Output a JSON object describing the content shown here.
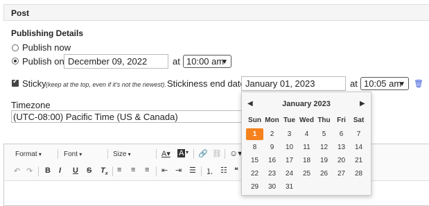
{
  "panel": {
    "title": "Post"
  },
  "publishing": {
    "heading": "Publishing Details",
    "publish_now_label": "Publish now",
    "publish_on_label": "Publish on",
    "publish_on_date": "December 09, 2022",
    "at_label": "at",
    "publish_on_time": "10:00 am",
    "sticky_label": "Sticky",
    "sticky_hint": "(keep at the top, even if it's not the newest).",
    "stickiness_label": "Stickiness end date",
    "stickiness_date": "January 01, 2023",
    "stickiness_time": "10:05 am",
    "timezone_label": "Timezone",
    "timezone_value": "(UTC-08:00) Pacific Time (US & Canada)"
  },
  "editor_toolbar": {
    "format_label": "Format",
    "font_label": "Font",
    "size_label": "Size"
  },
  "calendar": {
    "month_year": "January 2023",
    "weekdays": [
      "Sun",
      "Mon",
      "Tue",
      "Wed",
      "Thu",
      "Fri",
      "Sat"
    ],
    "selected_day": "1",
    "days": [
      [
        "1",
        "2",
        "3",
        "4",
        "5",
        "6",
        "7"
      ],
      [
        "8",
        "9",
        "10",
        "11",
        "12",
        "13",
        "14"
      ],
      [
        "15",
        "16",
        "17",
        "18",
        "19",
        "20",
        "21"
      ],
      [
        "22",
        "23",
        "24",
        "25",
        "26",
        "27",
        "28"
      ],
      [
        "29",
        "30",
        "31"
      ]
    ],
    "accent_color": "#f5821f"
  },
  "colors": {
    "trash_icon": "#3b5bdb"
  }
}
